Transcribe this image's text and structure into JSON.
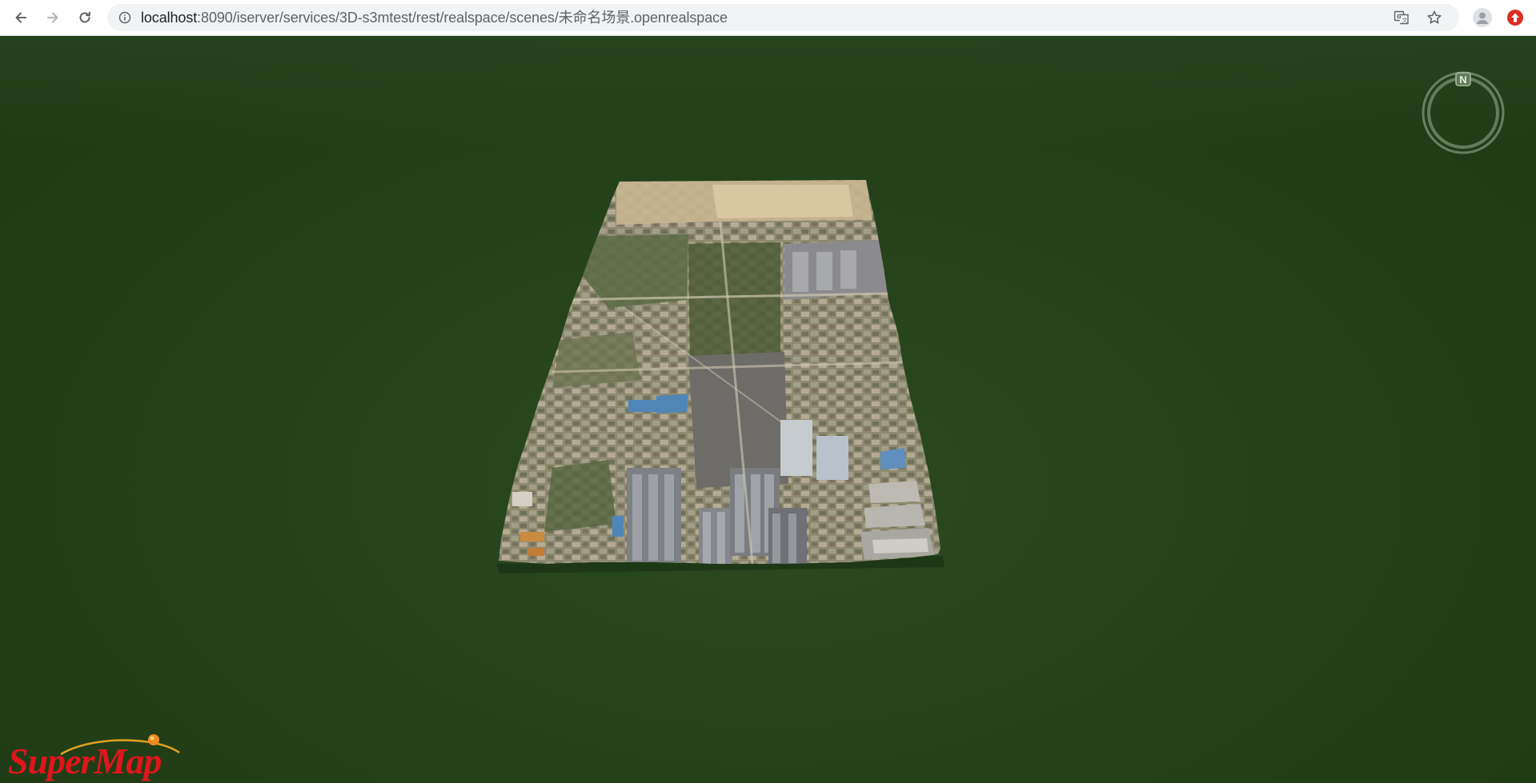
{
  "browser": {
    "back_icon": "arrow-left-icon",
    "forward_icon": "arrow-right-icon",
    "reload_icon": "reload-icon",
    "info_icon": "info-icon",
    "url_host": "localhost",
    "url_rest": ":8090/iserver/services/3D-s3mtest/rest/realspace/scenes/未命名场景.openrealspace",
    "translate_icon": "translate-icon",
    "bookmark_icon": "star-icon",
    "profile_icon": "account-icon",
    "update_icon": "update-available-icon"
  },
  "scene": {
    "background_color": "#234018",
    "compass_label": "N",
    "logo_text": "SuperMap",
    "logo_color": "#e0161c"
  }
}
